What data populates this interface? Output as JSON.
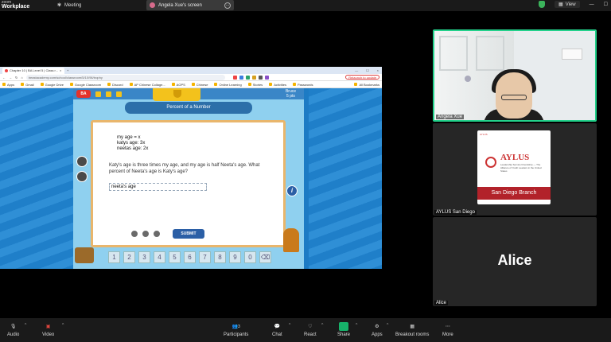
{
  "zoom": {
    "brand_small": "zoom",
    "brand": "Workplace",
    "meeting_label": "Meeting",
    "share_tab_label": "Angela Xue's screen",
    "view_label": "View",
    "colors": {
      "accent_green": "#23d18b",
      "share_green": "#17b26a",
      "bar": "#1a1a1a"
    }
  },
  "browser": {
    "tab_title": "Chapter 10 | BA Level 5 | Class r...",
    "url": "beastacademy.com/school/classroom/5/10/96/trophy",
    "relaunch": "Relaunch to update",
    "bookmarks": [
      "Apps",
      "Gmail",
      "Google Drive",
      "Google Classroom",
      "Discord",
      "AP Chinese Collage...",
      "AOPS",
      "Chinese",
      "Online Learning",
      "Stories",
      "Activities",
      "Passwords"
    ],
    "all_bookmarks": "All Bookmarks"
  },
  "game": {
    "player": "Bruce",
    "player_sub": "5 pts",
    "title": "Percent of a Number",
    "work_lines": [
      "my age = x",
      "katys age: 3x",
      "neetas age: 2x"
    ],
    "question": "Katy's age is three times my age, and my age is half Neeta's age. What percent of Neeta's age is Katy's age?",
    "answer": "neeta's age",
    "submit": "SUBMIT",
    "keys": [
      "1",
      "2",
      "3",
      "4",
      "5",
      "6",
      "7",
      "8",
      "9",
      "0"
    ]
  },
  "participants_tiles": [
    {
      "name": "Angela Xue"
    },
    {
      "name": "AYLUS San Diego",
      "card_title": "AYLUS",
      "card_tag": "AYLUS",
      "card_sub": "Leadership Service Friendship — The Alliance of Youth Leaders in the United States",
      "card_branch": "San Diego Branch"
    },
    {
      "name": "Alice",
      "big_name": "Alice"
    }
  ],
  "toolbar": {
    "audio": "Audio",
    "video": "Video",
    "participants": "Participants",
    "participants_count": "3",
    "chat": "Chat",
    "react": "React",
    "share": "Share",
    "apps": "Apps",
    "breakout": "Breakout rooms",
    "more": "More"
  }
}
